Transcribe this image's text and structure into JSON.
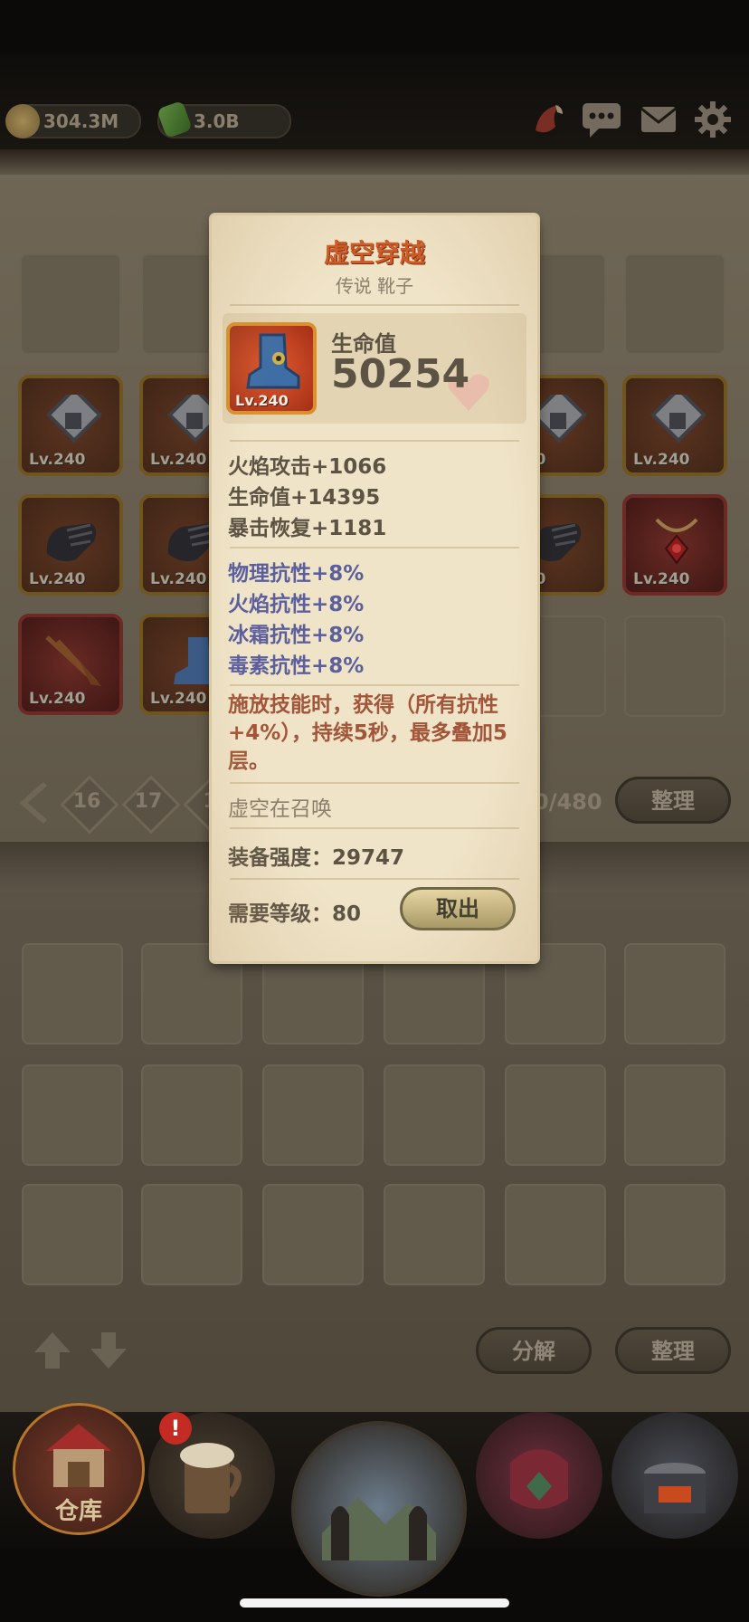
{
  "currency": {
    "gold": "304.3M",
    "gems": "3.0B"
  },
  "colors": {
    "title_orange": "#cf5a25",
    "resist_blue": "#5b5f9e",
    "passive_red": "#a3553a",
    "text_brown": "#5c5345",
    "parchment": "#f0e4c8"
  },
  "top_icons": [
    "horn-icon",
    "chat-icon",
    "mail-icon",
    "gear-icon"
  ],
  "grid_items": [
    {
      "level": "Lv.240",
      "icon": "gem-frame-icon"
    },
    {
      "level": "Lv.240",
      "icon": "gem-frame-icon"
    },
    {
      "level": "240",
      "icon": "gem-frame-icon"
    },
    {
      "level": "Lv.240",
      "icon": "gem-frame-icon"
    },
    {
      "level": "Lv.240",
      "icon": "gauntlet-icon"
    },
    {
      "level": "Lv.240",
      "icon": "gauntlet-icon"
    },
    {
      "level": "240",
      "icon": "gauntlet-icon"
    },
    {
      "level": "Lv.240",
      "icon": "amulet-icon"
    },
    {
      "level": "Lv.240",
      "icon": "spear-icon"
    },
    {
      "level": "Lv.240",
      "icon": "boot-icon"
    }
  ],
  "pagination": {
    "pages": [
      "16",
      "17",
      "1"
    ],
    "capacity": "0/480",
    "sort_label": "整理"
  },
  "tooltip": {
    "name": "虚空穿越",
    "rarity_type": "传说 靴子",
    "item_level": "Lv.240",
    "main_stat_label": "生命值",
    "main_stat_value": "50254",
    "stats": [
      "火焰攻击+1066",
      "生命值+14395",
      "暴击恢复+1181"
    ],
    "resists": [
      "物理抗性+8%",
      "火焰抗性+8%",
      "冰霜抗性+8%",
      "毒素抗性+8%"
    ],
    "passive": "施放技能时，获得（所有抗性+4%），持续5秒，最多叠加5层。",
    "set_name": "虚空在召唤",
    "power_label": "装备强度：29747",
    "required_level": "需要等级：80",
    "take_out_label": "取出"
  },
  "storage_bottom": {
    "decompose_label": "分解",
    "sort_label": "整理"
  },
  "bottom_nav": [
    {
      "label": "仓库",
      "icon": "warehouse-icon"
    },
    {
      "label": "",
      "icon": "tavern-mug-icon",
      "badge": "!"
    },
    {
      "label": "",
      "icon": "portal-icon"
    },
    {
      "label": "",
      "icon": "helmet-shield-icon"
    },
    {
      "label": "",
      "icon": "forge-icon"
    }
  ]
}
